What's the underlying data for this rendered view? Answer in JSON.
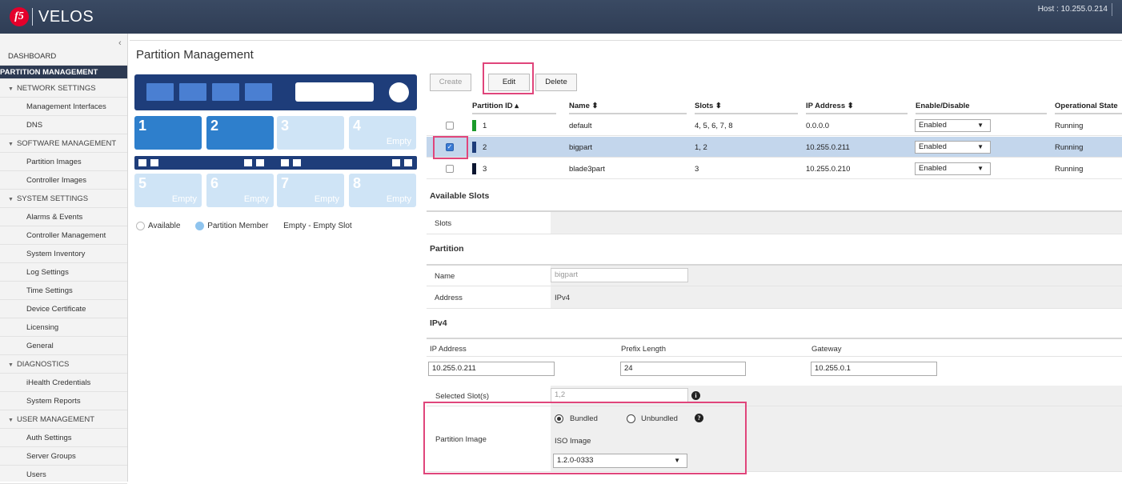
{
  "header": {
    "app_name": "VELOS",
    "logo": "f5",
    "host": "Host : 10.255.0.214"
  },
  "sidebar": {
    "collapse_icon": "‹",
    "items": [
      {
        "label": "DASHBOARD",
        "type": "top"
      },
      {
        "label": "PARTITION MANAGEMENT",
        "type": "active"
      },
      {
        "label": "NETWORK SETTINGS",
        "type": "section"
      },
      {
        "label": "Management Interfaces",
        "type": "sub"
      },
      {
        "label": "DNS",
        "type": "sub"
      },
      {
        "label": "SOFTWARE MANAGEMENT",
        "type": "section"
      },
      {
        "label": "Partition Images",
        "type": "sub"
      },
      {
        "label": "Controller Images",
        "type": "sub"
      },
      {
        "label": "SYSTEM SETTINGS",
        "type": "section"
      },
      {
        "label": "Alarms & Events",
        "type": "sub"
      },
      {
        "label": "Controller Management",
        "type": "sub"
      },
      {
        "label": "System Inventory",
        "type": "sub"
      },
      {
        "label": "Log Settings",
        "type": "sub"
      },
      {
        "label": "Time Settings",
        "type": "sub"
      },
      {
        "label": "Device Certificate",
        "type": "sub"
      },
      {
        "label": "Licensing",
        "type": "sub"
      },
      {
        "label": "General",
        "type": "sub"
      },
      {
        "label": "DIAGNOSTICS",
        "type": "section"
      },
      {
        "label": "iHealth Credentials",
        "type": "sub"
      },
      {
        "label": "System Reports",
        "type": "sub"
      },
      {
        "label": "USER MANAGEMENT",
        "type": "section"
      },
      {
        "label": "Auth Settings",
        "type": "sub"
      },
      {
        "label": "Server Groups",
        "type": "sub"
      },
      {
        "label": "Users",
        "type": "sub"
      }
    ]
  },
  "page": {
    "title": "Partition Management"
  },
  "chassis": {
    "slots": [
      {
        "num": "1",
        "state": "member",
        "empty_label": ""
      },
      {
        "num": "2",
        "state": "member",
        "empty_label": ""
      },
      {
        "num": "3",
        "state": "available",
        "empty_label": ""
      },
      {
        "num": "4",
        "state": "available",
        "empty_label": "Empty"
      },
      {
        "num": "5",
        "state": "available",
        "empty_label": "Empty"
      },
      {
        "num": "6",
        "state": "available",
        "empty_label": "Empty"
      },
      {
        "num": "7",
        "state": "available",
        "empty_label": "Empty"
      },
      {
        "num": "8",
        "state": "available",
        "empty_label": "Empty"
      }
    ],
    "legend": {
      "available": "Available",
      "member": "Partition Member",
      "empty": "Empty - Empty Slot"
    }
  },
  "toolbar": {
    "create": "Create",
    "edit": "Edit",
    "delete": "Delete"
  },
  "table": {
    "headers": {
      "partition_id": "Partition ID ▴",
      "name": "Name ⬍",
      "slots": "Slots ⬍",
      "ip": "IP Address ⬍",
      "enable": "Enable/Disable",
      "state": "Operational State"
    },
    "rows": [
      {
        "id": "1",
        "color": "#1a9a2a",
        "name": "default",
        "slots": "4, 5, 6, 7, 8",
        "ip": "0.0.0.0",
        "enable": "Enabled",
        "state": "Running",
        "checked": false
      },
      {
        "id": "2",
        "color": "#1e3d7a",
        "name": "bigpart",
        "slots": "1, 2",
        "ip": "10.255.0.211",
        "enable": "Enabled",
        "state": "Running",
        "checked": true
      },
      {
        "id": "3",
        "color": "#0b1530",
        "name": "blade3part",
        "slots": "3",
        "ip": "10.255.0.210",
        "enable": "Enabled",
        "state": "Running",
        "checked": false
      }
    ]
  },
  "available_slots": {
    "title": "Available Slots",
    "slots_label": "Slots"
  },
  "partition": {
    "title": "Partition",
    "name_label": "Name",
    "name_value": "bigpart",
    "address_label": "Address",
    "address_value": "IPv4"
  },
  "ipv4": {
    "title": "IPv4",
    "ip_label": "IP Address",
    "ip_value": "10.255.0.211",
    "prefix_label": "Prefix Length",
    "prefix_value": "24",
    "gateway_label": "Gateway",
    "gateway_value": "10.255.0.1"
  },
  "selected_slots": {
    "label": "Selected Slot(s)",
    "value": "1,2"
  },
  "partition_image": {
    "label": "Partition Image",
    "bundled": "Bundled",
    "unbundled": "Unbundled",
    "iso_label": "ISO Image",
    "iso_value": "1.2.0-0333"
  }
}
